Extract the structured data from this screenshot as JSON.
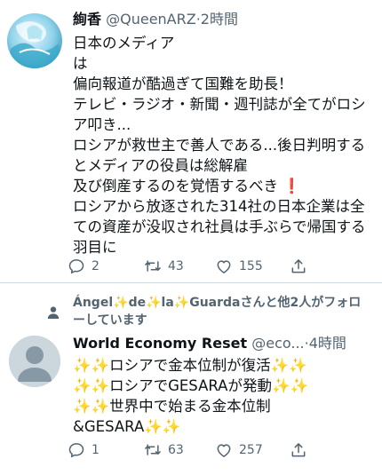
{
  "tweet1": {
    "display_name": "絢香",
    "handle": "@QueenARZ",
    "separator": "·",
    "time": "2時間",
    "lines": [
      "日本のメディア",
      "は",
      "偏向報道が酷過ぎて国難を助長！",
      "テレビ・ラジオ・新聞・週刊誌が全てがロシ",
      "ア叩き...",
      "ロシアが救世主で善人である...後日判明する",
      "とメディアの役員は総解雇",
      "及び倒産するのを覚悟するべき",
      "ロシアから放逐された314社の日本企業は全",
      "ての資産が没収され社員は手ぶらで帰国する",
      "羽目に"
    ],
    "exclaim_emoji": "❗",
    "reply_count": "2",
    "retweet_count": "43",
    "like_count": "155"
  },
  "social_context": {
    "line1_parts": [
      "Ángel",
      "✨",
      "de",
      "✨",
      "la",
      "✨",
      "Guardaさんと他2人がフォロ"
    ],
    "line2": "ーしています"
  },
  "tweet2": {
    "display_name": "World Economy Reset",
    "handle": "@eco...",
    "separator": "·",
    "time": "4時間",
    "lines": [
      {
        "pre": "✨✨",
        "text": "ロシアで金本位制が復活",
        "post": "✨✨"
      },
      {
        "pre": "✨✨",
        "text": "ロシアでGESARAが発動",
        "post": "✨✨"
      },
      {
        "pre": "✨✨",
        "text": "世界中で始まる金本位制",
        "post": ""
      },
      {
        "pre": "",
        "text": "&GESARA",
        "post": "✨✨"
      }
    ],
    "reply_count": "1",
    "retweet_count": "63",
    "like_count": "257"
  },
  "icons": {
    "reply": "reply-icon",
    "retweet": "retweet-icon",
    "like": "heart-icon",
    "share": "share-icon",
    "social": "person-icon",
    "sparkle": "sparkle-emoji"
  },
  "colors": {
    "text": "#0f1419",
    "secondary": "#536471",
    "divider": "#cfd9de",
    "exclaim": "#e0245e",
    "sparkle": "#f5c518",
    "avatar_placeholder": "#ccd6dd"
  }
}
